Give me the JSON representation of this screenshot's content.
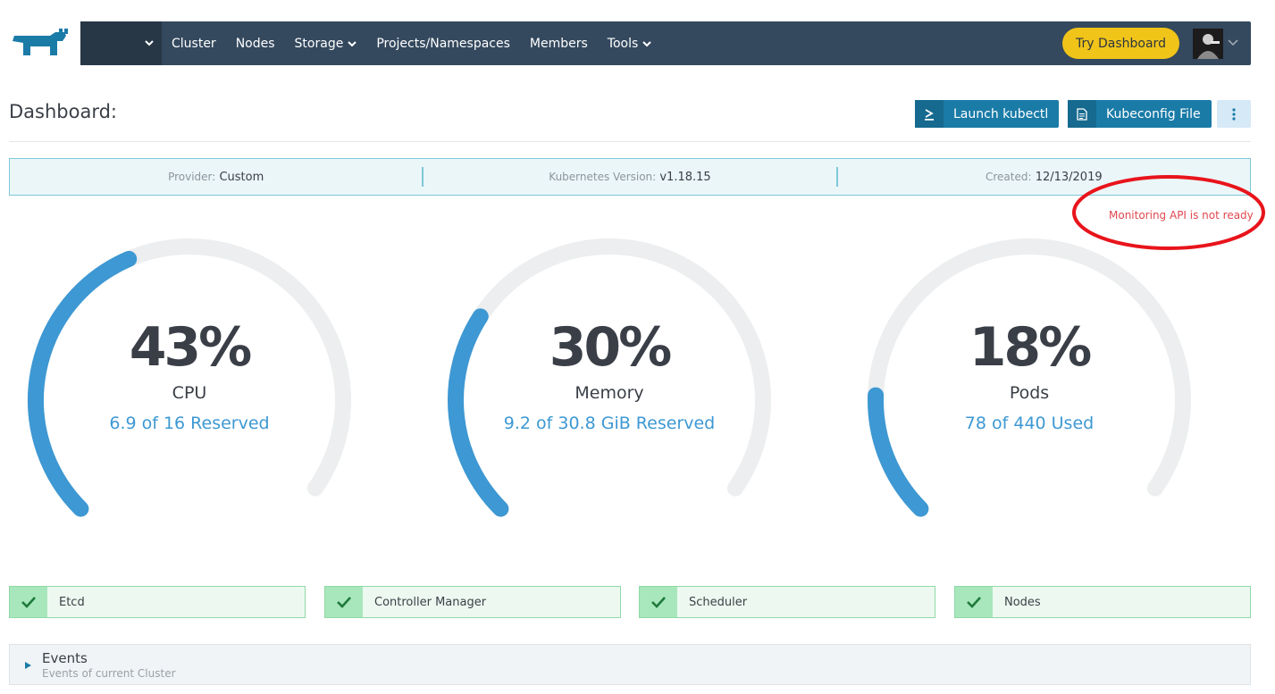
{
  "nav": {
    "items": [
      {
        "label": "Cluster",
        "dropdown": false
      },
      {
        "label": "Nodes",
        "dropdown": false
      },
      {
        "label": "Storage",
        "dropdown": true
      },
      {
        "label": "Projects/Namespaces",
        "dropdown": false
      },
      {
        "label": "Members",
        "dropdown": false
      },
      {
        "label": "Tools",
        "dropdown": true
      }
    ],
    "try_dashboard": "Try Dashboard"
  },
  "page": {
    "title": "Dashboard:",
    "launch_kubectl": "Launch kubectl",
    "kubeconfig_file": "Kubeconfig File"
  },
  "info": {
    "provider_label": "Provider:",
    "provider_value": "Custom",
    "k8s_label": "Kubernetes Version:",
    "k8s_value": "v1.18.15",
    "created_label": "Created:",
    "created_value": "12/13/2019"
  },
  "monitoring_note": "Monitoring API is not ready",
  "gauges": [
    {
      "pct": "43%",
      "fraction": 0.43,
      "label": "CPU",
      "sub": "6.9 of 16 Reserved"
    },
    {
      "pct": "30%",
      "fraction": 0.3,
      "label": "Memory",
      "sub": "9.2 of 30.8 GiB Reserved"
    },
    {
      "pct": "18%",
      "fraction": 0.18,
      "label": "Pods",
      "sub": "78 of 440 Used"
    }
  ],
  "components": [
    {
      "label": "Etcd"
    },
    {
      "label": "Controller Manager"
    },
    {
      "label": "Scheduler"
    },
    {
      "label": "Nodes"
    }
  ],
  "events": {
    "title": "Events",
    "subtitle": "Events of current Cluster"
  },
  "colors": {
    "nav_bg": "#34495e",
    "accent_yellow": "#f0c419",
    "primary_blue": "#1a7ba7",
    "gauge_blue": "#3d98d3",
    "gauge_track": "#eceeef",
    "healthy_green": "#8fd9a7",
    "annotation_red": "#e0474f"
  }
}
